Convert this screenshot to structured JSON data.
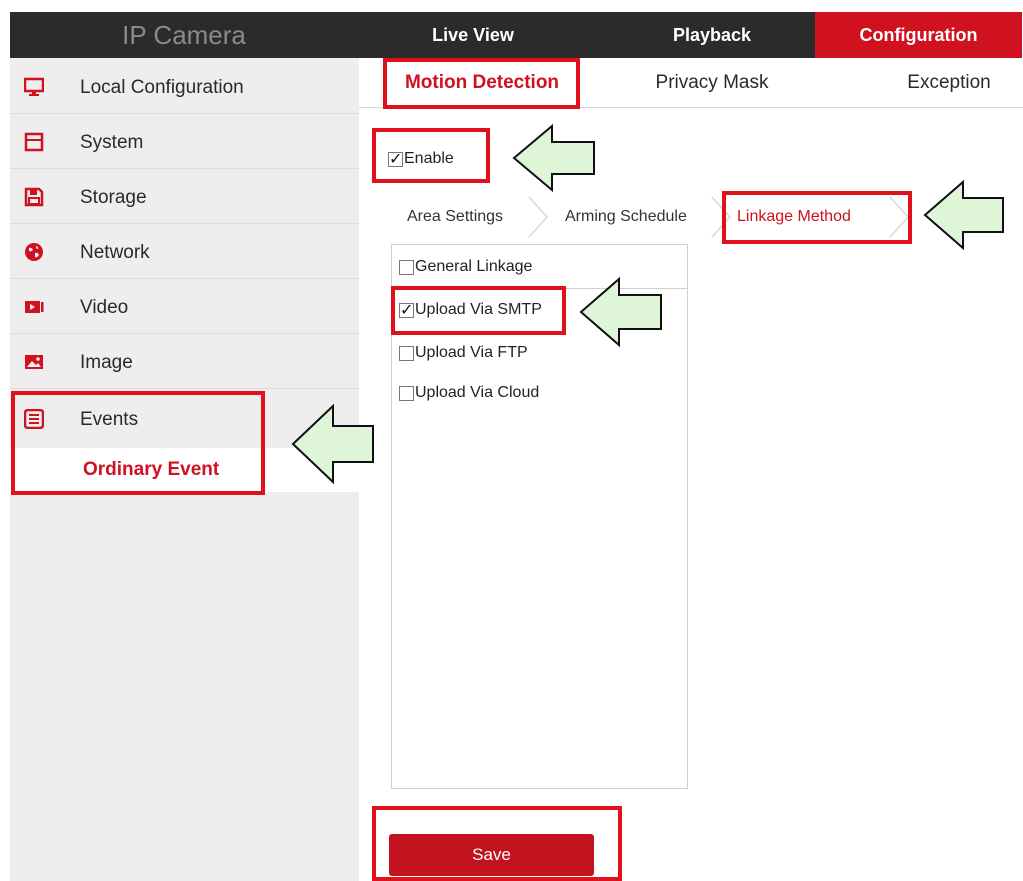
{
  "header": {
    "brand": "IP Camera",
    "tabs": {
      "live_view": "Live View",
      "playback": "Playback",
      "configuration": "Configuration"
    }
  },
  "sidebar": {
    "items": [
      {
        "label": "Local Configuration",
        "icon": "monitor-icon"
      },
      {
        "label": "System",
        "icon": "system-icon"
      },
      {
        "label": "Storage",
        "icon": "storage-icon"
      },
      {
        "label": "Network",
        "icon": "globe-icon"
      },
      {
        "label": "Video",
        "icon": "video-icon"
      },
      {
        "label": "Image",
        "icon": "image-icon"
      },
      {
        "label": "Events",
        "icon": "events-icon"
      }
    ],
    "sub_item": "Ordinary Event"
  },
  "main": {
    "subtabs": {
      "motion": "Motion Detection",
      "privacy": "Privacy Mask",
      "exception": "Exception"
    },
    "enable": {
      "label": "Enable",
      "checked": true
    },
    "breadcrumb": {
      "area": "Area Settings",
      "arming": "Arming Schedule",
      "linkage": "Linkage Method"
    },
    "linkage": {
      "header": {
        "label": "General Linkage",
        "checked": false
      },
      "options": [
        {
          "label": "Upload Via SMTP",
          "checked": true
        },
        {
          "label": "Upload Via FTP",
          "checked": false
        },
        {
          "label": "Upload Via Cloud",
          "checked": false
        }
      ]
    },
    "save_label": "Save"
  },
  "colors": {
    "accent": "#d0111f",
    "header_bg": "#2b2b2b",
    "sidebar_bg": "#eeeeee",
    "highlight": "#e0101c",
    "arrow_fill": "#dff5d8"
  }
}
